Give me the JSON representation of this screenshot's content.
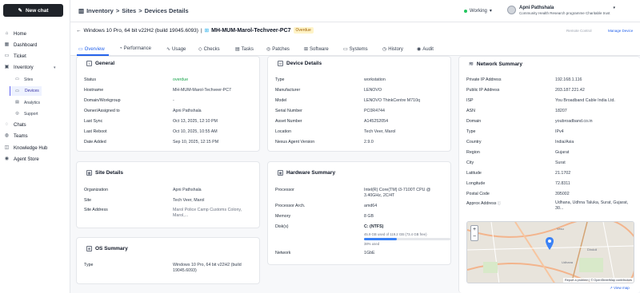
{
  "sidebar": {
    "new_chat": "New chat",
    "items": [
      {
        "label": "Home",
        "icon": "home-icon"
      },
      {
        "label": "Dashboard",
        "icon": "dashboard-icon"
      },
      {
        "label": "Ticket",
        "icon": "ticket-icon"
      },
      {
        "label": "Inventory",
        "icon": "inventory-icon"
      },
      {
        "label": "Sites",
        "icon": "sites-icon"
      },
      {
        "label": "Devices",
        "icon": "devices-icon"
      },
      {
        "label": "Analytics",
        "icon": "analytics-icon"
      },
      {
        "label": "Support",
        "icon": "support-icon"
      },
      {
        "label": "Chats",
        "icon": "chats-icon"
      },
      {
        "label": "Teams",
        "icon": "teams-icon"
      },
      {
        "label": "Knowledge Hub",
        "icon": "knowledge-icon"
      },
      {
        "label": "Agent Store",
        "icon": "agent-store-icon"
      }
    ]
  },
  "header": {
    "breadcrumb": [
      "Inventory",
      "Sites",
      "Devices Details"
    ],
    "status": "Working",
    "user_name": "Apni Pathshala",
    "user_org": "Community Health Research programme Charitable trust"
  },
  "device": {
    "os": "Windows 10 Pro, 64 bit v22H2 (build 19045.6093)",
    "name": "MH-MUM-Marol-Techveer-PC7",
    "badge": "Overdue",
    "remote": "Remote Control",
    "manage": "Manage Device"
  },
  "tabs": [
    "Overview",
    "Performance",
    "Usage",
    "Checks",
    "Tasks",
    "Patches",
    "Software",
    "Systems",
    "History",
    "Audit"
  ],
  "general": {
    "title": "General",
    "rows": [
      [
        "Status",
        "overdue"
      ],
      [
        "Hostname",
        "MH-MUM-Marol-Techveer-PC7"
      ],
      [
        "Domain/Workgroup",
        "-"
      ],
      [
        "Owner/Assigned to",
        "Apni Pathshala"
      ],
      [
        "Last Sync",
        "Oct 13, 2025, 12:10 PM"
      ],
      [
        "Last Reboot",
        "Oct 10, 2025, 10:55 AM"
      ],
      [
        "Date Added",
        "Sep 10, 2025, 12:15 PM"
      ]
    ]
  },
  "site": {
    "title": "Site Details",
    "rows": [
      [
        "Organization",
        "Apni Pathshala"
      ],
      [
        "Site",
        "Tech Veer, Marol"
      ],
      [
        "Site Address",
        "Marol Police Camp Customs Colony, Marol,..."
      ]
    ]
  },
  "os": {
    "title": "OS Summary",
    "rows": [
      [
        "Type",
        "Windows 10 Pro, 64 bit v22H2 (build 19045.6093)"
      ]
    ]
  },
  "devdetails": {
    "title": "Device Details",
    "rows": [
      [
        "Type",
        "workstation"
      ],
      [
        "Manufacturer",
        "LENOVO"
      ],
      [
        "Model",
        "LENOVO ThinkCentre M710q"
      ],
      [
        "Serial Number",
        "PC0R4744"
      ],
      [
        "Asset Number",
        "A145252054"
      ],
      [
        "Location",
        "Tech Veer, Marol"
      ],
      [
        "Nexus Agent Version",
        "2.9.0"
      ]
    ]
  },
  "hardware": {
    "title": "Hardware Summary",
    "processor_label": "Processor",
    "processor": "Intel(R) Core(TM) i3-7100T CPU @ 3.40GHz, 2C/4T",
    "arch_label": "Processor Arch.",
    "arch": "amd64",
    "memory_label": "Memory",
    "memory": "8 GB",
    "disk_label": "Disk(s)",
    "disk_name": "C: (NTFS)",
    "disk_used": "45.9 GB used of 119.2 GB (73.4 GB free)",
    "disk_pct_label": "38% used",
    "disk_fraction": 0.38,
    "network_label": "Network",
    "network": "1GbE"
  },
  "network": {
    "title": "Network Summary",
    "rows": [
      [
        "Private IP Address",
        "192.168.1.116"
      ],
      [
        "Public IP Address",
        "203.187.221.42"
      ],
      [
        "ISP",
        "You Broadband Cable India Ltd."
      ],
      [
        "ASN",
        "18207"
      ],
      [
        "Domain",
        "youbroadband.co.in"
      ],
      [
        "Type",
        "IPv4"
      ],
      [
        "Country",
        "India/Asia"
      ],
      [
        "Region",
        "Gujarat"
      ],
      [
        "City",
        "Surat"
      ],
      [
        "Latitude",
        "21.1702"
      ],
      [
        "Longitude",
        "72.8311"
      ],
      [
        "Postal Code",
        "395002"
      ],
      [
        "Approx Address",
        "Udhana, Udhna Taluka, Surat, Gujarat, 30..."
      ]
    ],
    "map_attrib": "Report a problem | © OpenStreetMap contributors",
    "map_labels": [
      "Vesu",
      "Dindoli",
      "Udhana"
    ],
    "view_map": "View map"
  }
}
